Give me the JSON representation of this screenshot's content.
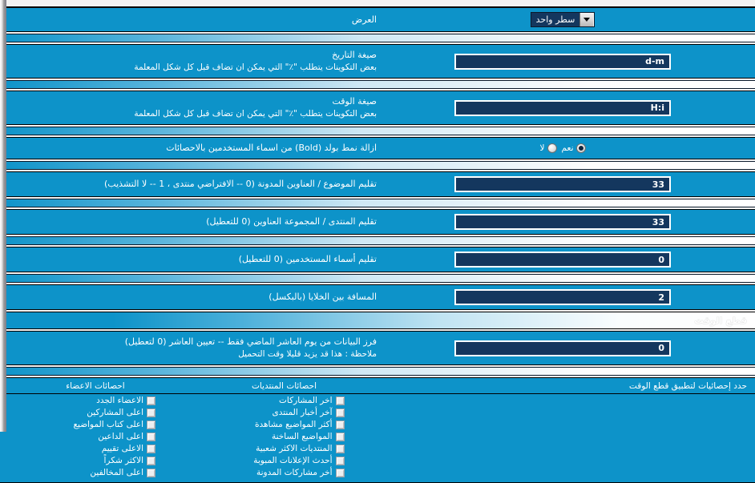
{
  "page": {
    "direction": "rtl",
    "accent_color": "#0d93c9",
    "input_bg": "#14375e",
    "text_color": "#ffffff"
  },
  "rows": {
    "display": {
      "label": "العرض",
      "select_value": "سطر واحد",
      "select_icon": "chevron-down-icon"
    },
    "date_format": {
      "label": "صيغة التاريخ",
      "sub": "بعض التكوينات يتطلب  \"٪\"  التي يمكن ان تضاف قبل كل شكل المعلمة",
      "value": "d-m"
    },
    "time_format": {
      "label": "صيغة الوقت",
      "sub": "بعض التكوينات يتطلب  \"٪\"  التي يمكن ان تضاف قبل كل شكل المعلمة",
      "value": "H:i"
    },
    "remove_bold": {
      "label": "ازالة نمط بولد  (Bold)  من اسماء المستخدمين بالاحصائات",
      "options": [
        {
          "label": "نعم",
          "selected": true
        },
        {
          "label": "لا",
          "selected": false
        }
      ]
    },
    "trim_thread": {
      "label": "تقليم الموضوع / العناوين المدونة (0 -- الافتراضي منتدى ، 1 -- لا التشذيب)",
      "value": "33"
    },
    "trim_forum": {
      "label": "تقليم المنتدى / المجموعة العناوين (0 للتعطيل)",
      "value": "33"
    },
    "trim_usernames": {
      "label": "تقليم أسماء المستخدمين (0 للتعطيل)",
      "value": "0"
    },
    "cell_spacing": {
      "label": "المسافة بين الخلايا (بالبكسل)",
      "value": "2"
    }
  },
  "section_timecut": {
    "title": "قطع الوقت",
    "sort_row": {
      "label": "فرز البيانات من يوم العاشر الماضي فقط -- تعيين العاشر (0 لتعطيل)",
      "sub": "ملاحظة : هذا قد يزيد قليلا وقت التحميل",
      "value": "0"
    },
    "columns": {
      "header_right": "حدد إحصائيات لتطبيق قطع الوقت",
      "header_mid": "احصائات المنتديات",
      "header_left": "احصائات الاعضاء",
      "forum_stats": [
        {
          "label": "اخر المشاركات",
          "checked": false
        },
        {
          "label": "آخر أخبار المنتدى",
          "checked": false
        },
        {
          "label": "أكثر المواضيع مشاهدة",
          "checked": false
        },
        {
          "label": "المواضيع الساخنة",
          "checked": false
        },
        {
          "label": "المنتديات الاكثر شعبية",
          "checked": false
        },
        {
          "label": "أحدث الإعلانات المبوبة",
          "checked": false
        },
        {
          "label": "أخر مشاركات المدونة",
          "checked": false
        }
      ],
      "member_stats": [
        {
          "label": "الاعضاء الجدد",
          "checked": false
        },
        {
          "label": "اعلى المشاركين",
          "checked": false
        },
        {
          "label": "اعلى كتاب المواضيع",
          "checked": false
        },
        {
          "label": "اعلى الداعين",
          "checked": false
        },
        {
          "label": "الاعلى تقييم",
          "checked": false
        },
        {
          "label": "الاكثر شكراً",
          "checked": false
        },
        {
          "label": "اعلى المخالفين",
          "checked": false
        }
      ]
    }
  }
}
